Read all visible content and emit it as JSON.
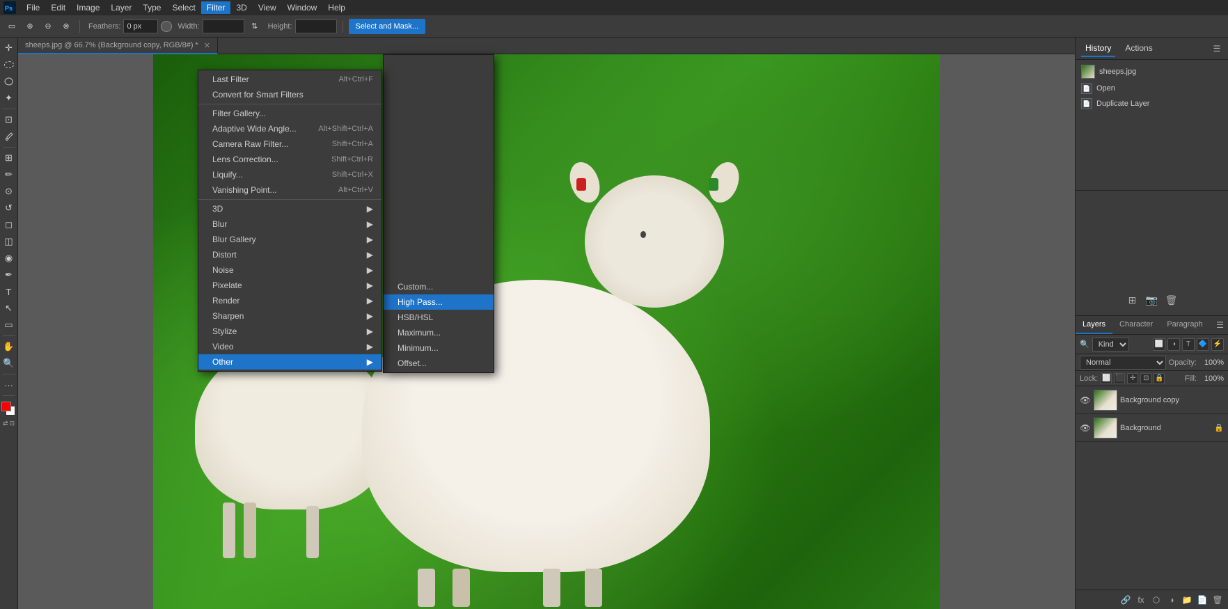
{
  "app": {
    "title": "sheeps.jpg @ 66.7% (Background copy, RGB/8#) *"
  },
  "menubar": {
    "items": [
      "PS",
      "File",
      "Edit",
      "Image",
      "Layer",
      "Type",
      "Select",
      "Filter",
      "3D",
      "View",
      "Window",
      "Help"
    ]
  },
  "toolbar": {
    "feathers_label": "Feathers:",
    "feathers_value": "",
    "width_label": "Width:",
    "width_value": "",
    "height_label": "Height:",
    "height_value": "",
    "select_mask_btn": "Select and Mask..."
  },
  "filter_menu": {
    "items": [
      {
        "label": "Last Filter",
        "shortcut": "Alt+Ctrl+F",
        "has_sub": false
      },
      {
        "label": "Convert for Smart Filters",
        "shortcut": "",
        "has_sub": false
      },
      {
        "label": "Filter Gallery...",
        "shortcut": "",
        "has_sub": false
      },
      {
        "label": "Adaptive Wide Angle...",
        "shortcut": "Alt+Shift+Ctrl+A",
        "has_sub": false
      },
      {
        "label": "Camera Raw Filter...",
        "shortcut": "Shift+Ctrl+A",
        "has_sub": false
      },
      {
        "label": "Lens Correction...",
        "shortcut": "Shift+Ctrl+R",
        "has_sub": false
      },
      {
        "label": "Liquify...",
        "shortcut": "Shift+Ctrl+X",
        "has_sub": false
      },
      {
        "label": "Vanishing Point...",
        "shortcut": "Alt+Ctrl+V",
        "has_sub": false
      },
      {
        "label": "3D",
        "shortcut": "",
        "has_sub": true
      },
      {
        "label": "Blur",
        "shortcut": "",
        "has_sub": true
      },
      {
        "label": "Blur Gallery",
        "shortcut": "",
        "has_sub": true
      },
      {
        "label": "Distort",
        "shortcut": "",
        "has_sub": true
      },
      {
        "label": "Noise",
        "shortcut": "",
        "has_sub": true
      },
      {
        "label": "Pixelate",
        "shortcut": "",
        "has_sub": true
      },
      {
        "label": "Render",
        "shortcut": "",
        "has_sub": true
      },
      {
        "label": "Sharpen",
        "shortcut": "",
        "has_sub": true
      },
      {
        "label": "Stylize",
        "shortcut": "",
        "has_sub": true
      },
      {
        "label": "Video",
        "shortcut": "",
        "has_sub": true
      },
      {
        "label": "Other",
        "shortcut": "",
        "has_sub": true,
        "highlighted": true
      }
    ]
  },
  "other_submenu": {
    "items": [
      {
        "label": "Custom...",
        "highlighted": false
      },
      {
        "label": "High Pass...",
        "highlighted": true
      },
      {
        "label": "HSB/HSL",
        "highlighted": false
      },
      {
        "label": "Maximum...",
        "highlighted": false
      },
      {
        "label": "Minimum...",
        "highlighted": false
      },
      {
        "label": "Offset...",
        "highlighted": false
      }
    ]
  },
  "history_panel": {
    "tab_history": "History",
    "tab_actions": "Actions",
    "filename": "sheeps.jpg",
    "items": [
      {
        "label": "Open"
      },
      {
        "label": "Duplicate Layer"
      }
    ]
  },
  "layers_panel": {
    "tabs": [
      "Layers",
      "Character",
      "Paragraph"
    ],
    "filter_label": "Kind",
    "blend_mode": "Normal",
    "opacity_label": "Opacity:",
    "opacity_value": "100%",
    "lock_label": "Lock:",
    "fill_label": "Fill:",
    "fill_value": "100%",
    "layers": [
      {
        "name": "Background copy",
        "visible": true,
        "locked": false
      },
      {
        "name": "Background",
        "visible": true,
        "locked": true
      }
    ]
  }
}
